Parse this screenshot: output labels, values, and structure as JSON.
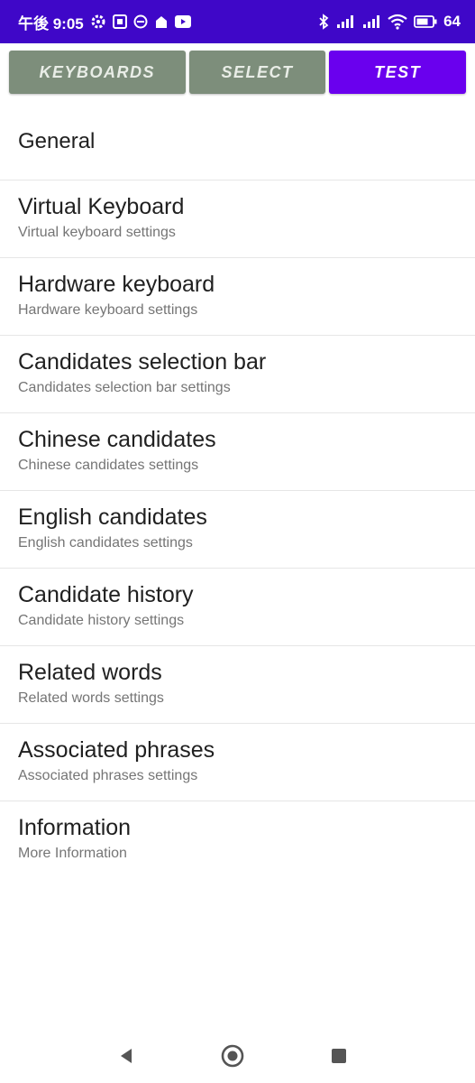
{
  "status_bar": {
    "time": "午後 9:05",
    "battery": "64"
  },
  "tabs": [
    {
      "label": "KEYBOARDS",
      "active": false
    },
    {
      "label": "SELECT",
      "active": false
    },
    {
      "label": "TEST",
      "active": true
    }
  ],
  "colors": {
    "status_bar": "#3f07c8",
    "tab_inactive": "#7d8e7b",
    "tab_active": "#6a00ee"
  },
  "section_header": "General",
  "items": [
    {
      "title": "Virtual Keyboard",
      "subtitle": "Virtual keyboard settings"
    },
    {
      "title": "Hardware keyboard",
      "subtitle": "Hardware keyboard settings"
    },
    {
      "title": "Candidates selection bar",
      "subtitle": "Candidates selection bar settings"
    },
    {
      "title": "Chinese candidates",
      "subtitle": "Chinese candidates settings"
    },
    {
      "title": "English candidates",
      "subtitle": "English candidates settings"
    },
    {
      "title": "Candidate history",
      "subtitle": "Candidate history settings"
    },
    {
      "title": "Related words",
      "subtitle": "Related words settings"
    },
    {
      "title": "Associated phrases",
      "subtitle": "Associated phrases settings"
    },
    {
      "title": "Information",
      "subtitle": "More Information"
    }
  ],
  "nav_icons": [
    "back-icon",
    "home-icon",
    "recents-icon"
  ]
}
